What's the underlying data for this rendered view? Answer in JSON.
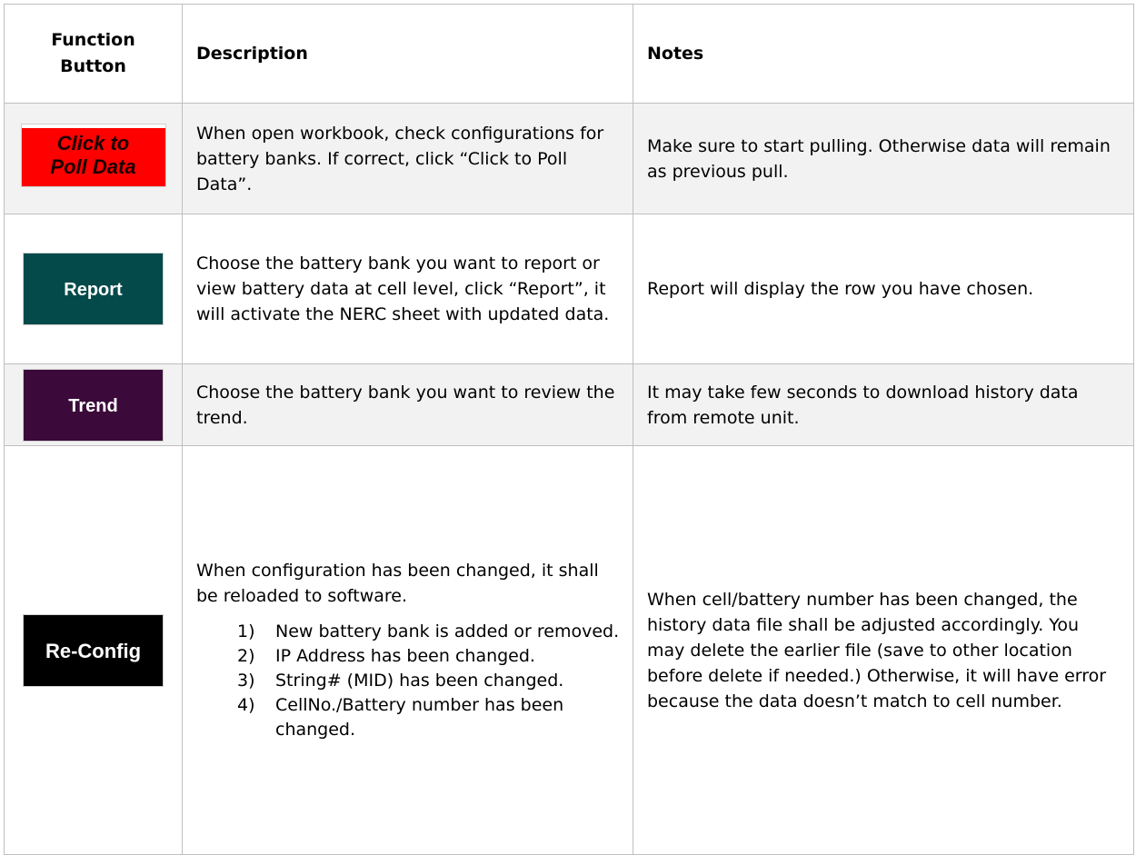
{
  "headers": {
    "function_button": "Function Button",
    "description": "Description",
    "notes": "Notes"
  },
  "rows": [
    {
      "button_label_line1": "Click to",
      "button_label_line2": "Poll Data",
      "button_color": "#ff0000",
      "description": "When open workbook, check configurations for battery banks. If correct, click “Click to Poll Data”.",
      "notes": "Make sure to start pulling. Otherwise data will remain as previous pull."
    },
    {
      "button_label": "Report",
      "button_color": "#054a4a",
      "description": "Choose the battery bank you want to report or view battery data at cell level, click “Report”, it will activate the NERC sheet with updated data.",
      "notes": "Report will display the row you have chosen."
    },
    {
      "button_label": "Trend",
      "button_color": "#3b0a3a",
      "description": "Choose the battery bank you want to review the trend.",
      "notes": "It may take few seconds to download history data from remote unit."
    },
    {
      "button_label": "Re-Config",
      "button_color": "#000000",
      "description": "When configuration has been changed, it shall be reloaded to software.",
      "list": [
        {
          "num": "1)",
          "text": "New battery bank is added or removed."
        },
        {
          "num": "2)",
          "text": "IP Address has been changed."
        },
        {
          "num": "3)",
          "text": "String# (MID) has been changed."
        },
        {
          "num": "4)",
          "text": "CellNo./Battery number has been changed."
        }
      ],
      "notes": "When cell/battery number has been changed, the history data file shall be adjusted accordingly. You may delete the earlier file (save to other location before delete if needed.) Otherwise, it will have error because the data doesn’t match to cell number."
    }
  ]
}
